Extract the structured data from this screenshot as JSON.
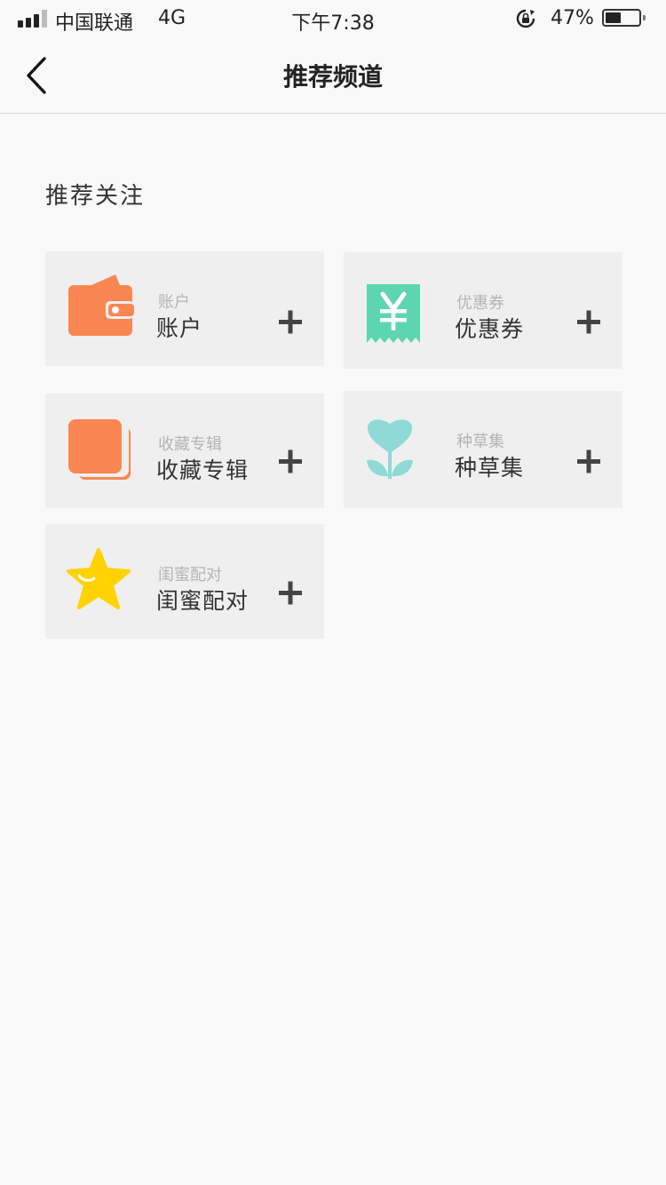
{
  "status_bar": {
    "carrier": "中国联通",
    "network": "4G",
    "time": "下午7:38",
    "battery": "47%",
    "battery_level": 0.47
  },
  "nav": {
    "title": "推荐频道"
  },
  "section": {
    "title": "推荐关注"
  },
  "cards": [
    {
      "small": "账户",
      "title": "账户",
      "icon": "wallet-icon",
      "color": "#fa8652"
    },
    {
      "small": "优惠券",
      "title": "优惠券",
      "icon": "coupon-icon",
      "color": "#5dd6b0"
    },
    {
      "small": "收藏专辑",
      "title": "收藏专辑",
      "icon": "album-icon",
      "color": "#fa8652"
    },
    {
      "small": "种草集",
      "title": "种草集",
      "icon": "plant-icon",
      "color": "#8fd9d6"
    },
    {
      "small": "闺蜜配对",
      "title": "闺蜜配对",
      "icon": "star-icon",
      "color": "#ffd200"
    }
  ]
}
